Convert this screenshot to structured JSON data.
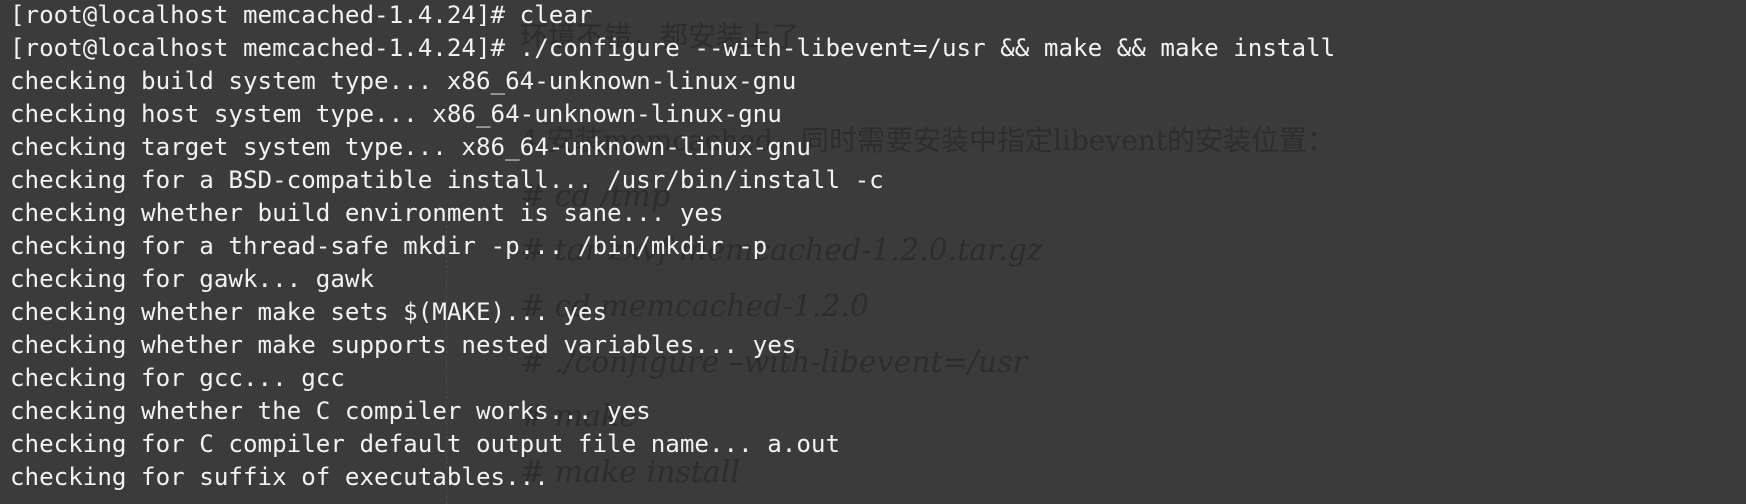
{
  "background_doc": {
    "lines": [
      "环境不错，都安装上了",
      "4.安装memcached，同时需要安装中指定libevent的安装位置：",
      "# cd /tmp",
      "# tar zxvf memcached-1.2.0.tar.gz",
      "# cd memcached-1.2.0",
      "# ./configure –with-libevent=/usr",
      "# make",
      "# make install"
    ]
  },
  "terminal": {
    "lines": [
      "[root@localhost memcached-1.4.24]# clear",
      "[root@localhost memcached-1.4.24]# ./configure --with-libevent=/usr && make && make install",
      "checking build system type... x86_64-unknown-linux-gnu",
      "checking host system type... x86_64-unknown-linux-gnu",
      "checking target system type... x86_64-unknown-linux-gnu",
      "checking for a BSD-compatible install... /usr/bin/install -c",
      "checking whether build environment is sane... yes",
      "checking for a thread-safe mkdir -p... /bin/mkdir -p",
      "checking for gawk... gawk",
      "checking whether make sets $(MAKE)... yes",
      "checking whether make supports nested variables... yes",
      "checking for gcc... gcc",
      "checking whether the C compiler works... yes",
      "checking for C compiler default output file name... a.out",
      "checking for suffix of executables..."
    ]
  },
  "colors": {
    "background": "#3b3b3b",
    "terminal_text": "#f2f2f2",
    "ghost_text": "#232323"
  }
}
